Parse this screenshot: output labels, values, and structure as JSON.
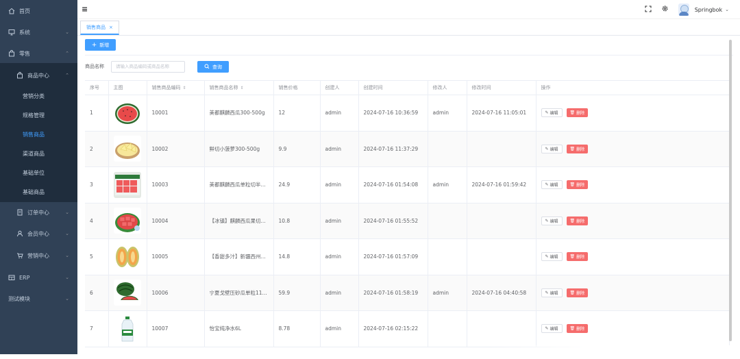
{
  "sidebar": {
    "items": [
      {
        "label": "首页",
        "icon": "home-icon",
        "level": 0
      },
      {
        "label": "系统",
        "icon": "monitor-icon",
        "level": 0,
        "expanded": false
      },
      {
        "label": "零售",
        "icon": "bag-icon",
        "level": 0,
        "expanded": true
      },
      {
        "label": "商品中心",
        "icon": "bag-icon",
        "level": 1,
        "expanded": true
      },
      {
        "label": "营销分类",
        "level": 2
      },
      {
        "label": "规格管理",
        "level": 2
      },
      {
        "label": "销售商品",
        "level": 2,
        "active": true
      },
      {
        "label": "渠道商品",
        "level": 2
      },
      {
        "label": "基础单位",
        "level": 2
      },
      {
        "label": "基础商品",
        "level": 2
      },
      {
        "label": "订单中心",
        "icon": "order-icon",
        "level": 1,
        "expanded": false
      },
      {
        "label": "会员中心",
        "icon": "user-icon",
        "level": 1,
        "expanded": false
      },
      {
        "label": "营销中心",
        "icon": "cart-icon",
        "level": 1,
        "expanded": false
      },
      {
        "label": "ERP",
        "icon": "erp-icon",
        "level": 0,
        "expanded": false
      },
      {
        "label": "测试模块",
        "level": 0,
        "expanded": false
      }
    ]
  },
  "navbar": {
    "username": "Springbok"
  },
  "tags": {
    "active_tab": "销售商品",
    "close": "×"
  },
  "toolbar": {
    "add_label": "新增",
    "search_label": "商品名称",
    "search_placeholder": "请输入商品编码或商品名称",
    "query_label": "查询"
  },
  "table": {
    "headers": {
      "index": "序号",
      "image": "主图",
      "code": "销售商品编码",
      "name": "销售商品名称",
      "price": "销售价格",
      "creator": "创建人",
      "created": "创建时间",
      "modifier": "修改人",
      "modified": "修改时间",
      "actions": "操作"
    },
    "edit_label": "编辑",
    "delete_label": "删除",
    "rows": [
      {
        "index": "1",
        "image": "watermelon-half",
        "code": "10001",
        "name": "美都麒麟西瓜300-500g",
        "price": "12",
        "creator": "admin",
        "created": "2024-07-16 10:36:59",
        "modifier": "admin",
        "modified": "2024-07-16 11:05:01"
      },
      {
        "index": "2",
        "image": "pineapple-pieces",
        "code": "10002",
        "name": "鲜切小菠萝300-500g",
        "price": "9.9",
        "creator": "admin",
        "created": "2024-07-16 11:37:29",
        "modifier": "",
        "modified": ""
      },
      {
        "index": "3",
        "image": "watermelon-cubes-box",
        "code": "10003",
        "name": "美都麒麟西瓜单粒切半...",
        "price": "24.9",
        "creator": "admin",
        "created": "2024-07-16 01:54:08",
        "modifier": "admin",
        "modified": "2024-07-16 01:59:42"
      },
      {
        "index": "4",
        "image": "watermelon-cubes-bowl",
        "code": "10004",
        "name": "【冰镇】麒麟西瓜果切...",
        "price": "10.8",
        "creator": "admin",
        "created": "2024-07-16 01:55:52",
        "modifier": "",
        "modified": ""
      },
      {
        "index": "5",
        "image": "melon-halves",
        "code": "10005",
        "name": "【香甜多汁】新疆西州...",
        "price": "14.8",
        "creator": "admin",
        "created": "2024-07-16 01:57:09",
        "modifier": "",
        "modified": ""
      },
      {
        "index": "6",
        "image": "watermelon-whole",
        "code": "10006",
        "name": "宁夏戈壁压砂瓜单粒11...",
        "price": "59.9",
        "creator": "admin",
        "created": "2024-07-16 01:58:19",
        "modifier": "admin",
        "modified": "2024-07-16 04:40:58"
      },
      {
        "index": "7",
        "image": "water-bottle",
        "code": "10007",
        "name": "怡宝纯净水6L",
        "price": "8.78",
        "creator": "admin",
        "created": "2024-07-16 02:15:22",
        "modifier": "",
        "modified": ""
      }
    ]
  },
  "colors": {
    "sidebar_bg": "#304156",
    "submenu_bg": "#1f2d3d",
    "primary": "#409eff",
    "danger": "#f56c6c"
  }
}
